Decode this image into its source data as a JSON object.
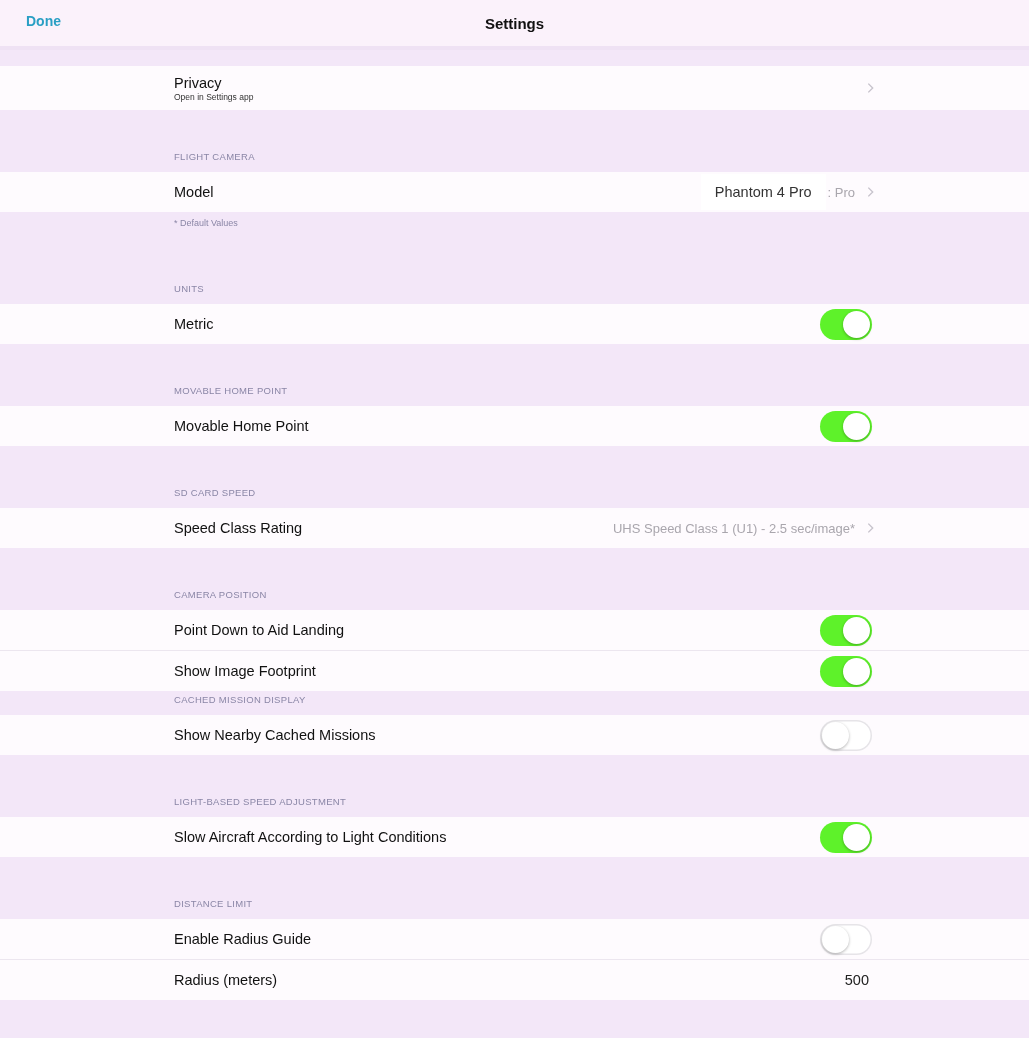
{
  "nav_bar": {
    "left_button": "Done",
    "title": "Settings"
  },
  "sections": [
    {
      "rows": [
        {
          "kind": "link",
          "label": "Privacy",
          "subtitle": "Open in Settings app"
        }
      ]
    },
    {
      "header": "FLIGHT CAMERA",
      "footer": "* Default Values",
      "rows": [
        {
          "kind": "link",
          "label": "Model",
          "value": "Phantom 4 Pro",
          "value_fragment": ": Pro"
        }
      ]
    },
    {
      "header": "UNITS",
      "rows": [
        {
          "kind": "toggle",
          "label": "Metric",
          "on": true
        }
      ]
    },
    {
      "header": "MOVABLE HOME POINT",
      "rows": [
        {
          "kind": "toggle",
          "label": "Movable Home Point",
          "on": true
        }
      ]
    },
    {
      "header": "SD CARD SPEED",
      "rows": [
        {
          "kind": "link",
          "label": "Speed Class Rating",
          "value_fragment": "UHS Speed Class 1 (U1) - 2.5 sec/image*"
        }
      ]
    },
    {
      "header": "CAMERA POSITION",
      "rows": [
        {
          "kind": "toggle",
          "label": "Point Down to Aid Landing",
          "on": true
        },
        {
          "kind": "toggle",
          "label": "Show Image Footprint",
          "on": true
        }
      ]
    },
    {
      "header": "CACHED MISSION DISPLAY",
      "rows": [
        {
          "kind": "toggle",
          "label": "Show Nearby Cached Missions",
          "on": false
        }
      ]
    },
    {
      "header": "LIGHT-BASED SPEED ADJUSTMENT",
      "rows": [
        {
          "kind": "toggle",
          "label": "Slow Aircraft According to Light Conditions",
          "on": true
        }
      ]
    },
    {
      "header": "DISTANCE LIMIT",
      "rows": [
        {
          "kind": "toggle",
          "label": "Enable Radius Guide",
          "on": false
        },
        {
          "kind": "value",
          "label": "Radius (meters)",
          "value": "500"
        }
      ]
    }
  ]
}
